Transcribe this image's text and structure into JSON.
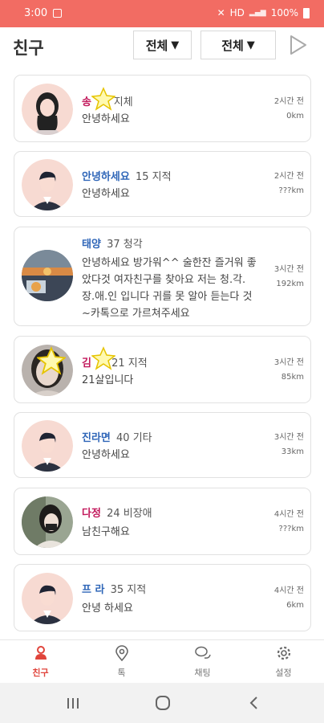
{
  "status_bar": {
    "time": "3:00",
    "network": "HD",
    "battery": "100%"
  },
  "header": {
    "title": "친구",
    "filter1": "전체",
    "filter2": "전체",
    "arrow": "▼"
  },
  "friends": [
    {
      "name": "송",
      "info": "32 지체",
      "message": "안녕하세요",
      "time": "2시간 전",
      "distance": "0km"
    },
    {
      "name": "안녕하세요",
      "info": "15 지적",
      "message": "안녕하세요",
      "time": "2시간 전",
      "distance": "???km"
    },
    {
      "name": "태양",
      "info": "37 청각",
      "message": "안녕하세요 방가워^^ 술한잔 즐거워 좋았다것 여자친구를 찾아요 저는 청.각.장.애.인 입니다   귀를 못 알아 듣는다 것~카톡으로 가르쳐주세요",
      "time": "3시간 전",
      "distance": "192km"
    },
    {
      "name": "김",
      "info": "21 지적",
      "message": "21살입니다",
      "time": "3시간 전",
      "distance": "85km"
    },
    {
      "name": "진라면",
      "info": "40 기타",
      "message": "안녕하세요",
      "time": "3시간 전",
      "distance": "33km"
    },
    {
      "name": "다정",
      "info": "24 비장애",
      "message": "남친구해요",
      "time": "4시간 전",
      "distance": "???km"
    },
    {
      "name": "프 라",
      "info": "35 지적",
      "message": "안녕 하세요",
      "time": "4시간 전",
      "distance": "6km"
    }
  ],
  "bottom_nav": [
    {
      "label": "친구",
      "icon": "person-icon",
      "active": true
    },
    {
      "label": "톡",
      "icon": "location-pin-icon",
      "active": false
    },
    {
      "label": "채팅",
      "icon": "chat-bubbles-icon",
      "active": false
    },
    {
      "label": "설정",
      "icon": "gear-icon",
      "active": false
    }
  ],
  "colors": {
    "accent": "#f26c63",
    "active_tab": "#e0443b",
    "male_name": "#2f66b8",
    "female_name": "#c2185b"
  }
}
